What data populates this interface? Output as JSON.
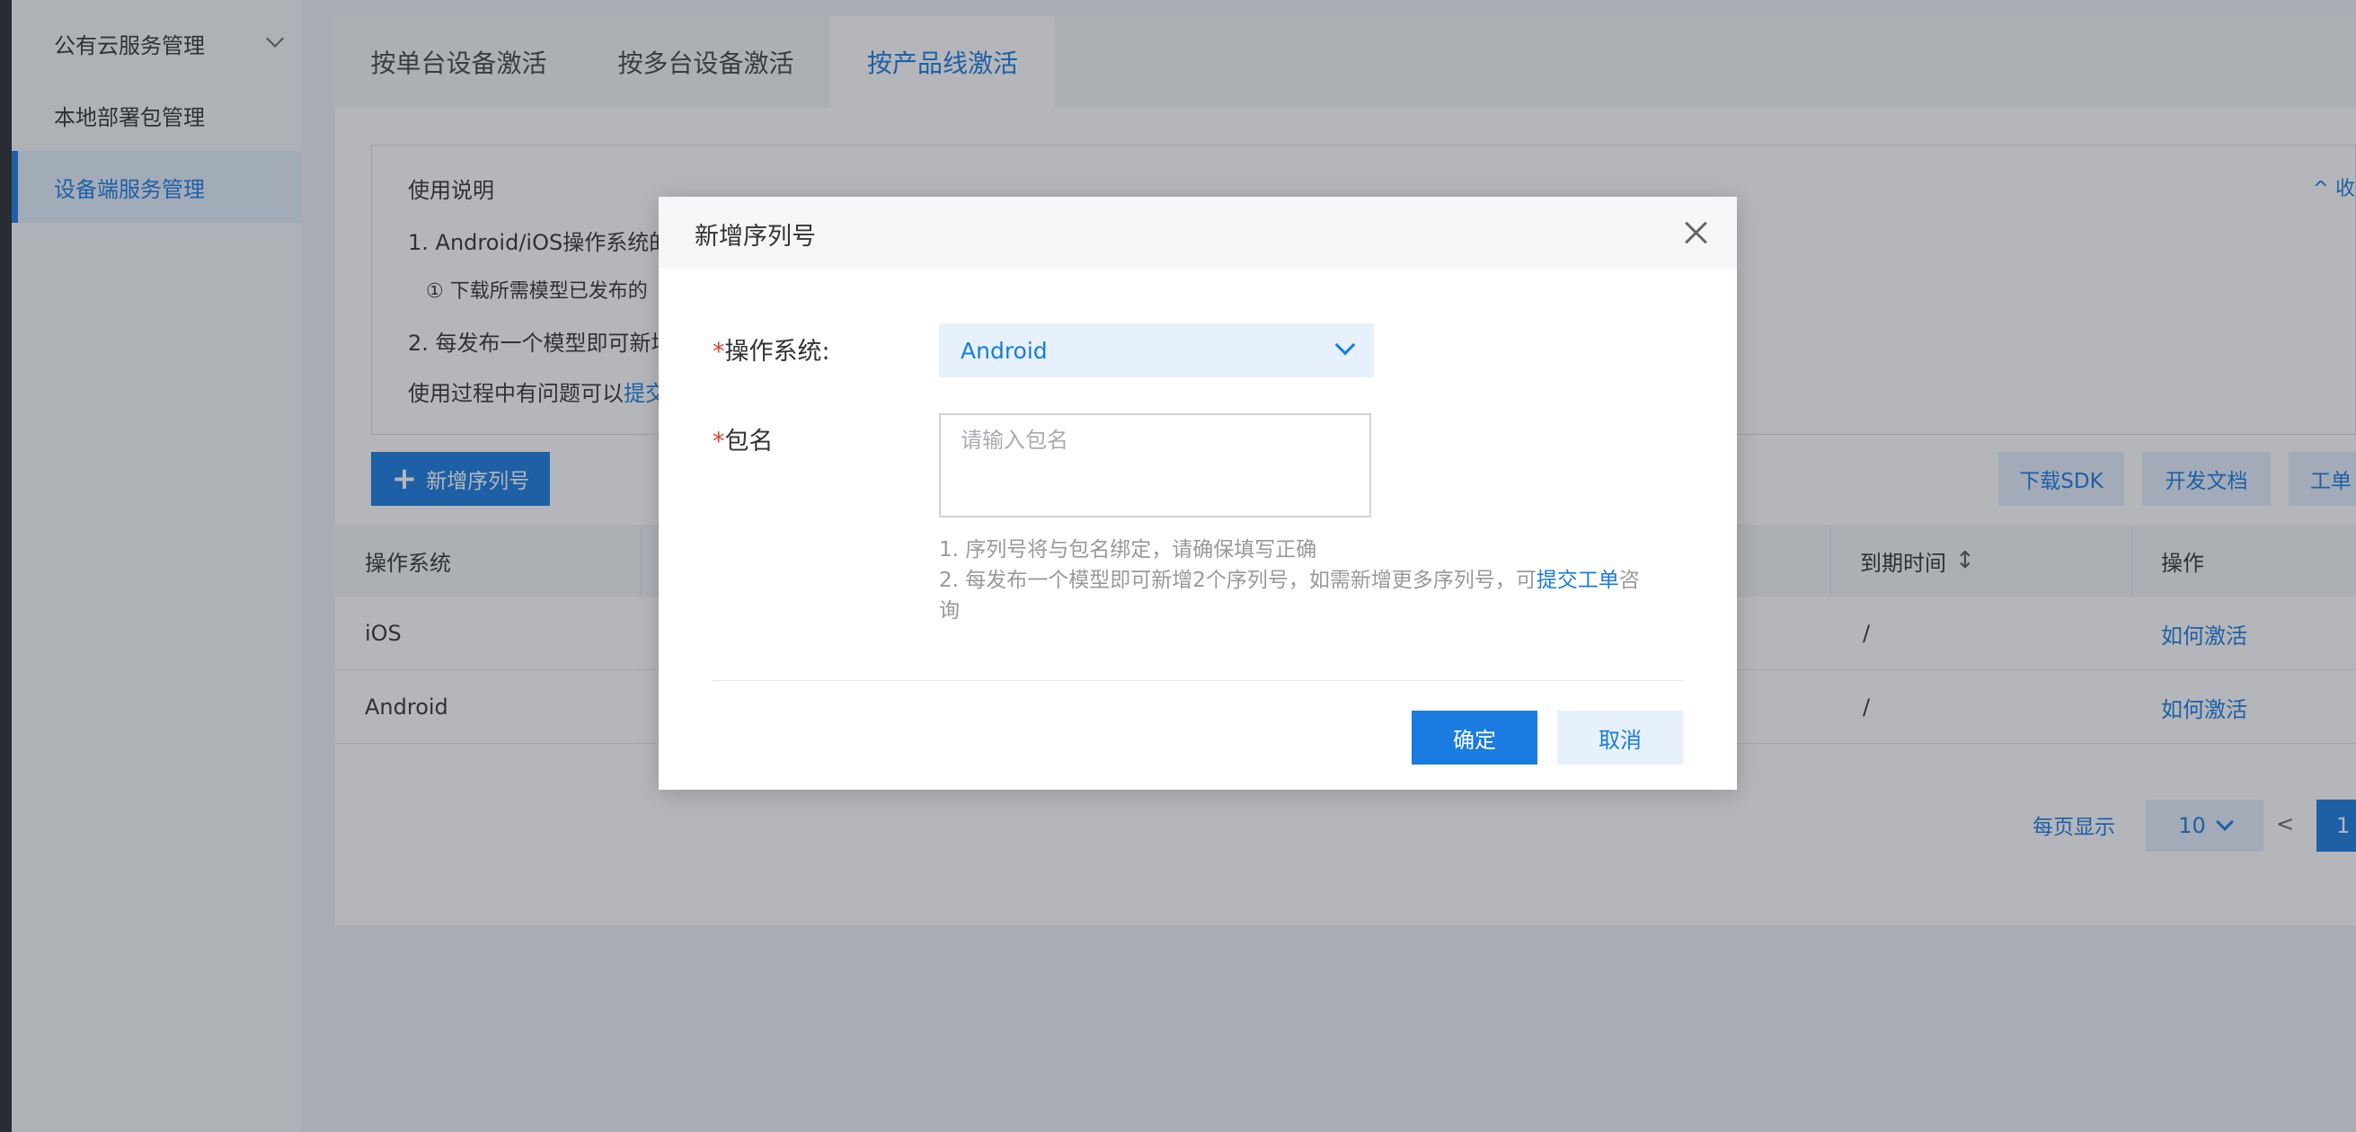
{
  "sidebar": {
    "items": [
      {
        "label": "公有云服务管理"
      },
      {
        "label": "本地部署包管理"
      },
      {
        "label": "设备端服务管理"
      }
    ]
  },
  "tabs": [
    {
      "label": "按单台设备激活"
    },
    {
      "label": "按多台设备激活"
    },
    {
      "label": "按产品线激活"
    }
  ],
  "notice": {
    "title": "使用说明",
    "collapse_label": "^ 收",
    "line1": "1. Android/iOS操作系统的",
    "line2": "① 下载所需模型已发布的",
    "line3": "2. 每发布一个模型即可新增",
    "line4_prefix": "使用过程中有问题可以",
    "line4_link": "提交"
  },
  "toolbar": {
    "add_label": "新增序列号",
    "download_sdk_label": "下载SDK",
    "docs_label": "开发文档",
    "ticket_label": "工单"
  },
  "table": {
    "headers": {
      "os": "操作系统",
      "expiry": "到期时间",
      "actions": "操作"
    },
    "rows": [
      {
        "os": "iOS",
        "expiry": "/",
        "action": "如何激活"
      },
      {
        "os": "Android",
        "expiry": "/",
        "action": "如何激活"
      }
    ]
  },
  "pagination": {
    "per_page_label": "每页显示",
    "per_page_value": "10",
    "prev": "<",
    "current": "1"
  },
  "modal": {
    "title": "新增序列号",
    "os_label": "操作系统:",
    "os_value": "Android",
    "package_label": "包名",
    "package_placeholder": "请输入包名",
    "hint1": "1. 序列号将与包名绑定，请确保填写正确",
    "hint2_prefix": "2. 每发布一个模型即可新增2个序列号，如需新增更多序列号，可",
    "hint2_link": "提交工单",
    "hint2_suffix": "咨",
    "hint2_wrap": "询",
    "ok_label": "确定",
    "cancel_label": "取消"
  }
}
